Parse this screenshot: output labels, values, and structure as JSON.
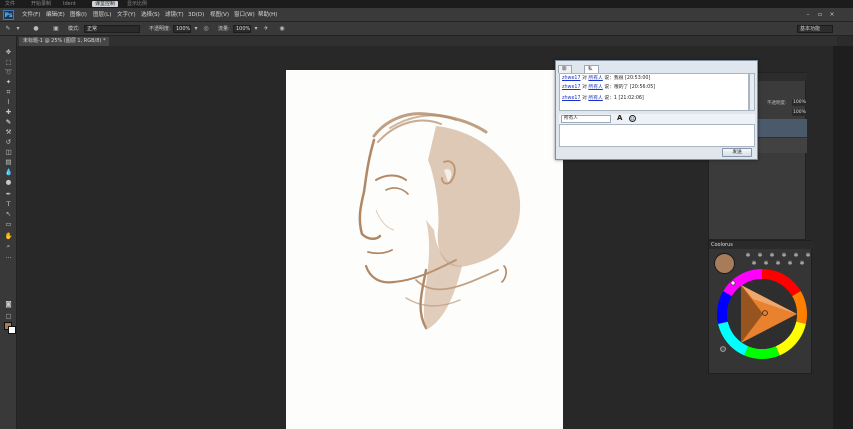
{
  "topbar": {
    "buttons": [
      "文件",
      "开始录制",
      "Ident",
      "课堂控制",
      "显示比例"
    ],
    "active_index": 3
  },
  "menubar": {
    "logo": "Ps",
    "items": [
      "文件(F)",
      "编辑(E)",
      "图像(I)",
      "图层(L)",
      "文字(Y)",
      "选择(S)",
      "滤镜(T)",
      "3D(D)",
      "视图(V)",
      "窗口(W)",
      "帮助(H)"
    ]
  },
  "options": {
    "mode_label": "模式:",
    "mode_value": "正常",
    "opacity_label": "不透明度:",
    "opacity_value": "100%",
    "flow_label": "流量:",
    "flow_value": "100%",
    "workspace": "基本功能"
  },
  "document": {
    "tab_label": "未标题-1 @ 25% (图层 1, RGB/8) *"
  },
  "layers": {
    "opacity_label": "不透明度:",
    "opacity_value": "100%",
    "fill_value": "100%"
  },
  "coolorus": {
    "tab": "Coolorus",
    "current_color": "#a67c5b"
  },
  "chat": {
    "tabs": [
      "聊天(F)",
      "私聊(O)"
    ],
    "active_tab": 1,
    "messages": [
      {
        "user": "zhwe17",
        "mid": " 对 ",
        "to": "所有人",
        "text": " 说：我很 [20:53:00]"
      },
      {
        "user": "zhwe17",
        "mid": " 对 ",
        "to": "所有人",
        "text": " 说：哦的了 [20:56:05]"
      },
      {
        "user": "zhwe17",
        "mid": " 对 ",
        "to": "所有人",
        "text": " 说：1 [21:02:06]"
      }
    ],
    "recipient": "所有人",
    "send_label": "发送"
  },
  "colors": {
    "foreground": "#a67c5b",
    "background": "#ffffff",
    "sketch": "#b08866"
  }
}
